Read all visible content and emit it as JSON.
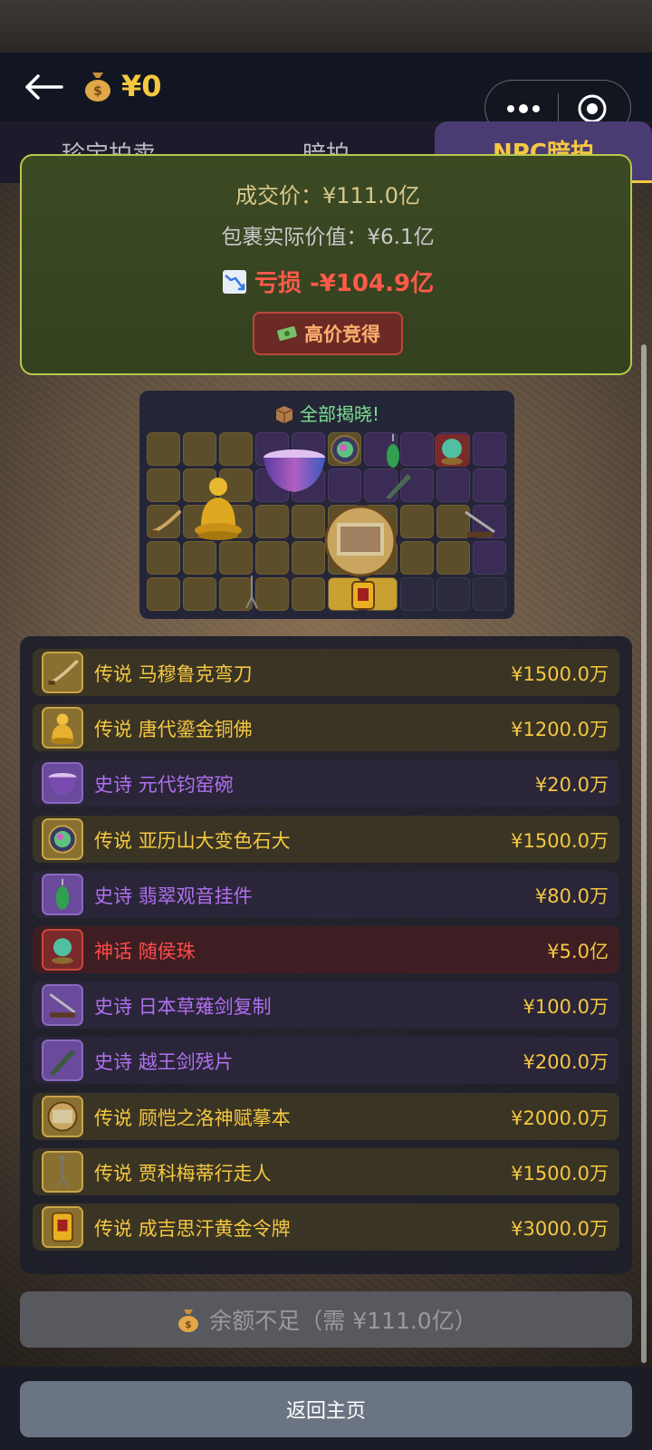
{
  "header": {
    "balance": "¥0"
  },
  "tabs": [
    {
      "label": "珍宝拍卖",
      "active": false
    },
    {
      "label": "暗拍",
      "active": false
    },
    {
      "label": "NPC暗拍",
      "active": true
    }
  ],
  "result": {
    "deal_price": "成交价：¥111.0亿",
    "actual_value": "包裹实际价值：¥6.1亿",
    "loss": "亏损 -¥104.9亿",
    "badge": "高价竞得"
  },
  "reveal": {
    "title": "全部揭晓!"
  },
  "items": [
    {
      "rarity": "传说",
      "name": "马穆鲁克弯刀",
      "price": "¥1500.0万",
      "tier": "legend",
      "icon": "sabre-icon"
    },
    {
      "rarity": "传说",
      "name": "唐代鎏金铜佛",
      "price": "¥1200.0万",
      "tier": "legend",
      "icon": "buddha-icon"
    },
    {
      "rarity": "史诗",
      "name": "元代钧窑碗",
      "price": "¥20.0万",
      "tier": "epic",
      "icon": "bowl-icon"
    },
    {
      "rarity": "传说",
      "name": "亚历山大变色石大",
      "price": "¥1500.0万",
      "tier": "legend",
      "icon": "gem-icon"
    },
    {
      "rarity": "史诗",
      "name": "翡翠观音挂件",
      "price": "¥80.0万",
      "tier": "epic",
      "icon": "jade-pendant-icon"
    },
    {
      "rarity": "神话",
      "name": "随侯珠",
      "price": "¥5.0亿",
      "tier": "myth",
      "icon": "pearl-icon"
    },
    {
      "rarity": "史诗",
      "name": "日本草薙剑复制",
      "price": "¥100.0万",
      "tier": "epic",
      "icon": "sword-stand-icon"
    },
    {
      "rarity": "史诗",
      "name": "越王剑残片",
      "price": "¥200.0万",
      "tier": "epic",
      "icon": "sword-fragment-icon"
    },
    {
      "rarity": "传说",
      "name": "顾恺之洛神赋摹本",
      "price": "¥2000.0万",
      "tier": "legend",
      "icon": "scroll-painting-icon"
    },
    {
      "rarity": "传说",
      "name": "贾科梅蒂行走人",
      "price": "¥1500.0万",
      "tier": "legend",
      "icon": "walking-man-icon"
    },
    {
      "rarity": "传说",
      "name": "成吉思汗黄金令牌",
      "price": "¥3000.0万",
      "tier": "legend",
      "icon": "gold-tablet-icon"
    }
  ],
  "insufficient_label": "余额不足（需 ¥111.0亿）",
  "home_label": "返回主页",
  "colors": {
    "gold": "#f5c842",
    "epic": "#b070f0",
    "myth": "#ff4a4a",
    "tab_active_bg": "#4b3b73"
  }
}
